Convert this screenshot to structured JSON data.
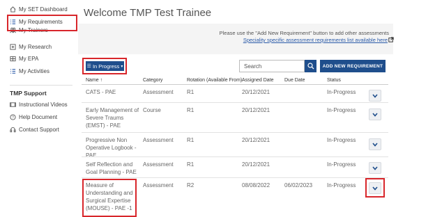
{
  "sidebar": {
    "items": [
      {
        "label": "My SET Dashboard",
        "icon": "home-icon"
      },
      {
        "label": "My Requirements",
        "icon": "list-icon"
      },
      {
        "label": "My Trainers",
        "icon": "people-icon"
      },
      {
        "label": "My Research",
        "icon": "plus-square-icon"
      },
      {
        "label": "My EPA",
        "icon": "grid-icon"
      },
      {
        "label": "My Activities",
        "icon": "list-icon"
      }
    ],
    "support_heading": "TMP Support",
    "support_items": [
      {
        "label": "Instructional Videos",
        "icon": "video-icon"
      },
      {
        "label": "Help Document",
        "icon": "help-icon"
      },
      {
        "label": "Contact Support",
        "icon": "support-icon"
      }
    ]
  },
  "header": {
    "welcome": "Welcome TMP Test Trainee",
    "info_text": "Please use the \"Add New Requirement\" button to add other assessments",
    "info_link": "Speciality specific assessment requirements list available here"
  },
  "toolbar": {
    "filter_label": "In Progress",
    "search_placeholder": "Search",
    "add_button": "ADD NEW REQUIREMENT"
  },
  "table": {
    "headers": [
      "Name",
      "Category",
      "Rotation (Available From)",
      "Assigned Date",
      "Due Date",
      "Status"
    ],
    "sort_indicator": "↑",
    "rows": [
      {
        "name": "CATS - PAE",
        "category": "Assessment",
        "rotation": "R1",
        "assigned": "20/12/2021",
        "due": "",
        "status": "In-Progress"
      },
      {
        "name": "Early Management of Severe Traums (EMST) - PAE",
        "category": "Course",
        "rotation": "R1",
        "assigned": "20/12/2021",
        "due": "",
        "status": "In-Progress"
      },
      {
        "name": "Progressive Non Operative Logbook - PAE",
        "category": "Assessment",
        "rotation": "R1",
        "assigned": "20/12/2021",
        "due": "",
        "status": "In-Progress"
      },
      {
        "name": "Self Reflection and Goal Planning - PAE",
        "category": "Assessment",
        "rotation": "R1",
        "assigned": "20/12/2021",
        "due": "",
        "status": "In-Progress"
      },
      {
        "name": "Measure of Understanding and Surgical Expertise (MOUSE) - PAE -1",
        "category": "Assessment",
        "rotation": "R2",
        "assigned": "08/08/2022",
        "due": "06/02/2023",
        "status": "In-Progress"
      }
    ]
  },
  "colors": {
    "primary": "#1f4e8c",
    "highlight": "#d8262b",
    "link": "#2a5aa8"
  }
}
